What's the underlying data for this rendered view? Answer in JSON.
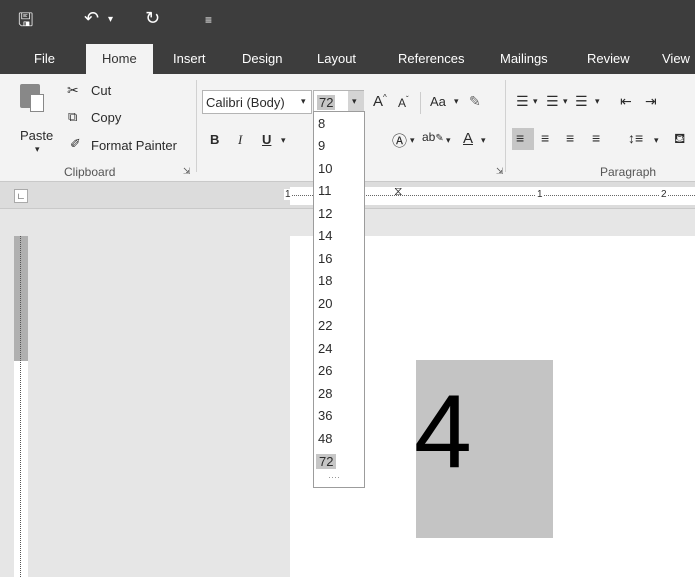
{
  "tabs": [
    "File",
    "Home",
    "Insert",
    "Design",
    "Layout",
    "References",
    "Mailings",
    "Review",
    "View"
  ],
  "clipboard": {
    "paste": "Paste",
    "cut": "Cut",
    "copy": "Copy",
    "format_painter": "Format Painter",
    "group_label": "Clipboard"
  },
  "font": {
    "name": "Calibri (Body)",
    "size": "72",
    "bold": "B",
    "italic": "I",
    "underline": "U",
    "case": "Aa",
    "size_options": [
      "8",
      "9",
      "10",
      "11",
      "12",
      "14",
      "16",
      "18",
      "20",
      "22",
      "24",
      "26",
      "28",
      "36",
      "48",
      "72"
    ]
  },
  "paragraph": {
    "group_label": "Paragraph"
  },
  "ruler": {
    "marks": [
      "1",
      "1",
      "2"
    ]
  },
  "document": {
    "text": "4"
  }
}
